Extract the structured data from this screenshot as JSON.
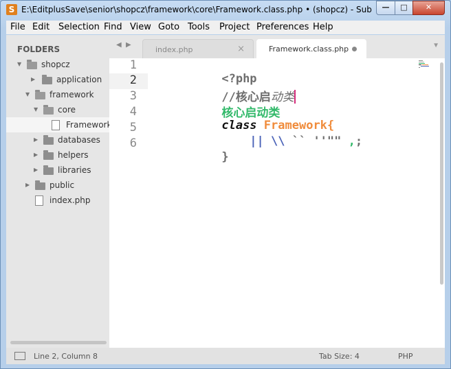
{
  "window": {
    "title": "E:\\EditplusSave\\senior\\shopcz\\framework\\core\\Framework.class.php • (shopcz) - Subli...",
    "buttons": {
      "minimize": "—",
      "maximize": "□",
      "close": "✕"
    }
  },
  "menu": [
    "File",
    "Edit",
    "Selection",
    "Find",
    "View",
    "Goto",
    "Tools",
    "Project",
    "Preferences",
    "Help"
  ],
  "sidebar": {
    "header": "FOLDERS",
    "items": [
      {
        "label": "shopcz",
        "type": "folder",
        "expanded": true
      },
      {
        "label": "application",
        "type": "folder",
        "expanded": false
      },
      {
        "label": "framework",
        "type": "folder",
        "expanded": true
      },
      {
        "label": "core",
        "type": "folder",
        "expanded": true
      },
      {
        "label": "Framework.class.php",
        "type": "file",
        "selected": true
      },
      {
        "label": "databases",
        "type": "folder",
        "expanded": false
      },
      {
        "label": "helpers",
        "type": "folder",
        "expanded": false
      },
      {
        "label": "libraries",
        "type": "folder",
        "expanded": false
      },
      {
        "label": "public",
        "type": "folder",
        "expanded": false
      },
      {
        "label": "index.php",
        "type": "file"
      }
    ]
  },
  "tabs": [
    {
      "label": "index.php",
      "active": false,
      "close": "×"
    },
    {
      "label": "Framework.class.php",
      "active": true,
      "modified": true
    }
  ],
  "editor": {
    "line_numbers": [
      "1",
      "2",
      "3",
      "4",
      "5",
      "6"
    ],
    "current_line": 2,
    "lines": {
      "l1": "<?php",
      "l2a": "//核心启",
      "l2b": "动类",
      "l3": "核心启动类",
      "l4_kw": "class",
      "l4_name": "Framework",
      "l4_brace": "{",
      "l5_pipes": "    ||",
      "l5_bs": " \\\\",
      "l5_rest": " `` ''\"\"",
      "l5_comma": " ,",
      "l5_semi": ";",
      "l6": "}"
    }
  },
  "status": {
    "position": "Line 2, Column 8",
    "tab_size": "Tab Size: 4",
    "syntax": "PHP"
  },
  "colors": {
    "caret": "#d42a7a",
    "string_green": "#32b96a",
    "class_orange": "#f08c3c"
  }
}
